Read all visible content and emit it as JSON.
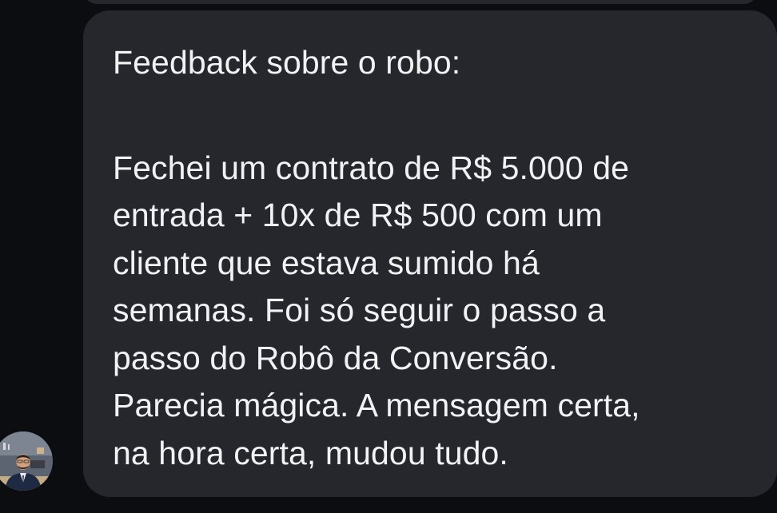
{
  "message": {
    "title": "Feedback sobre o robo:",
    "lines": [
      "Fechei um contrato de R$ 5.000 de",
      "entrada + 10x de R$ 500 com um",
      "cliente que estava sumido há",
      "semanas. Foi só seguir o passo a",
      "passo do Robô da Conversão.",
      "Parecia mágica. A mensagem certa,",
      "na hora certa, mudou tudo."
    ]
  },
  "avatar": {
    "icon": "user-avatar-photo"
  }
}
